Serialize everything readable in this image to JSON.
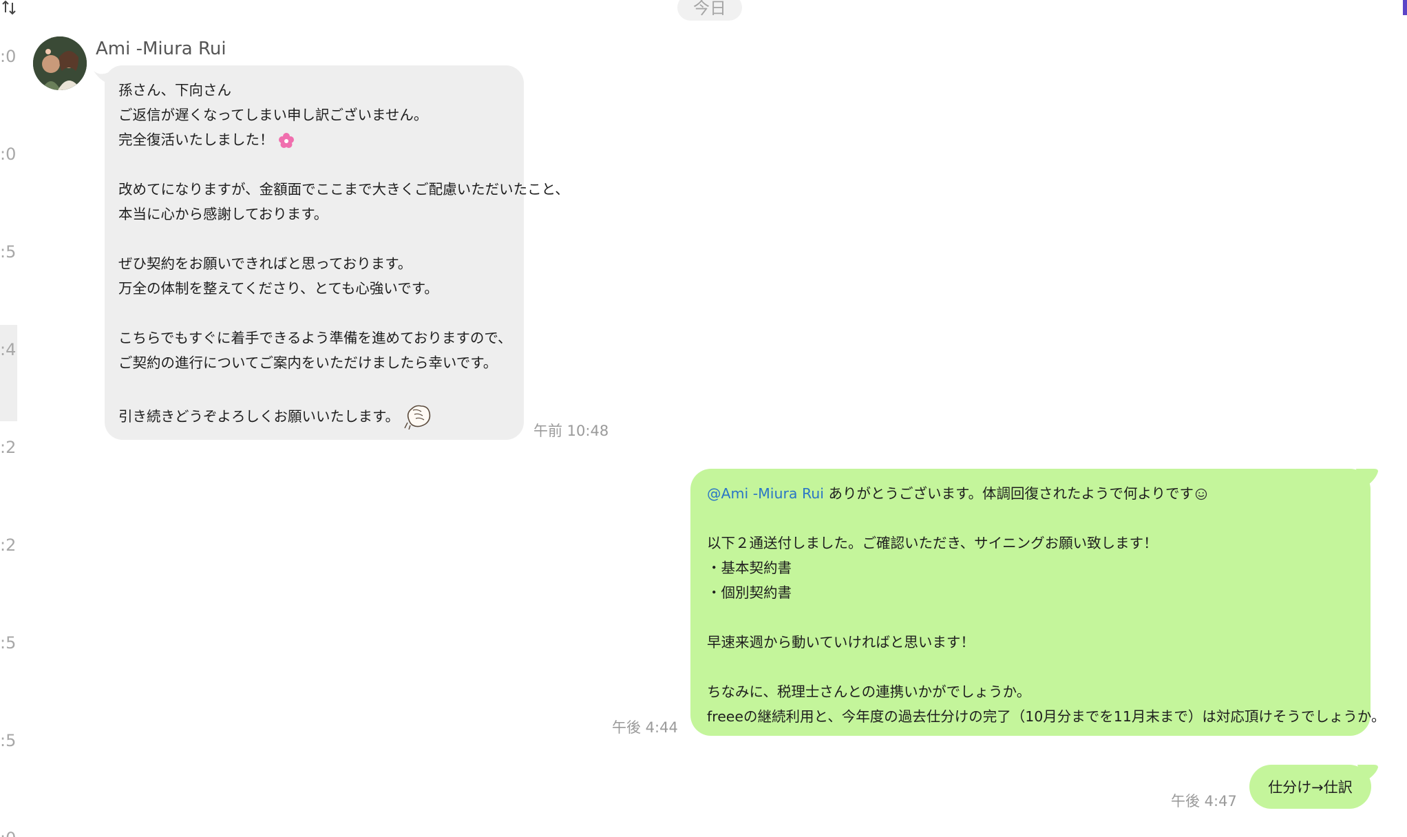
{
  "sidebar": {
    "times": [
      ":0",
      ":0",
      ":5",
      ":4",
      ":2",
      ":2",
      ":5",
      ":5",
      ":0"
    ]
  },
  "date_separator": "今日",
  "incoming": {
    "sender": "Ami -Miura Rui",
    "lines": [
      "孫さん、下向さん",
      "ご返信が遅くなってしまい申し訳ございません。",
      "完全復活いたしました！",
      "",
      "改めてになりますが、金額面でここまで大きくご配慮いただいたこと、",
      "本当に心から感謝しております。",
      "",
      "ぜひ契約をお願いできればと思っております。",
      "万全の体制を整えてくださり、とても心強いです。",
      "",
      "こちらでもすぐに着手できるよう準備を進めておりますので、",
      "ご契約の進行についてご案内をいただけましたら幸いです。",
      "",
      "引き続きどうぞよろしくお願いいたします。"
    ],
    "time": "午前 10:48"
  },
  "outgoing": {
    "mention": "@Ami -Miura Rui",
    "first_line_rest": " ありがとうございます。体調回復されたようで何よりです",
    "lines": [
      "",
      "以下２通送付しました。ご確認いただき、サイニングお願い致します！",
      "・基本契約書",
      "・個別契約書",
      "",
      "早速来週から動いていければと思います！",
      "",
      "ちなみに、税理士さんとの連携いかがでしょうか。",
      "freeeの継続利用と、今年度の過去仕分けの完了（10月分までを11月末まで）は対応頂けそうでしょうか。"
    ],
    "time": "午後 4:44"
  },
  "outgoing_2": {
    "text": "仕分け→仕訳",
    "time": "午後 4:47"
  },
  "colors": {
    "incoming_bubble": "#eeeeee",
    "outgoing_bubble": "#c4f59b",
    "mention": "#2a75c6",
    "accent": "#5b45c7"
  },
  "icons": [
    "sort-icon",
    "flower-emoji",
    "smile-emoji",
    "hand-sticker"
  ]
}
